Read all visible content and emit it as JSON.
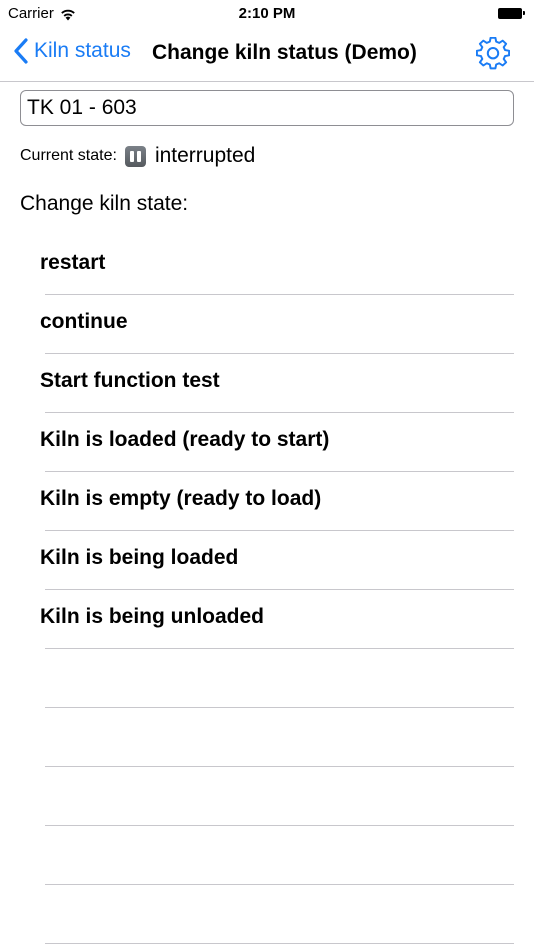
{
  "status_bar": {
    "carrier": "Carrier",
    "time": "2:10 PM"
  },
  "nav": {
    "back_label": "Kiln status",
    "title": "Change kiln status (Demo)",
    "accent_color": "#1a7cf5",
    "settings_icon": "gear-icon"
  },
  "kiln": {
    "value": "TK 01 - 603"
  },
  "current_state": {
    "label": "Current state:",
    "icon": "pause-icon",
    "value": "interrupted"
  },
  "change_heading": "Change kiln state:",
  "states": [
    {
      "label": "restart"
    },
    {
      "label": "continue"
    },
    {
      "label": "Start function test"
    },
    {
      "label": "Kiln is loaded (ready to start)"
    },
    {
      "label": "Kiln is empty (ready to load)"
    },
    {
      "label": "Kiln is being loaded"
    },
    {
      "label": "Kiln is being unloaded"
    }
  ]
}
